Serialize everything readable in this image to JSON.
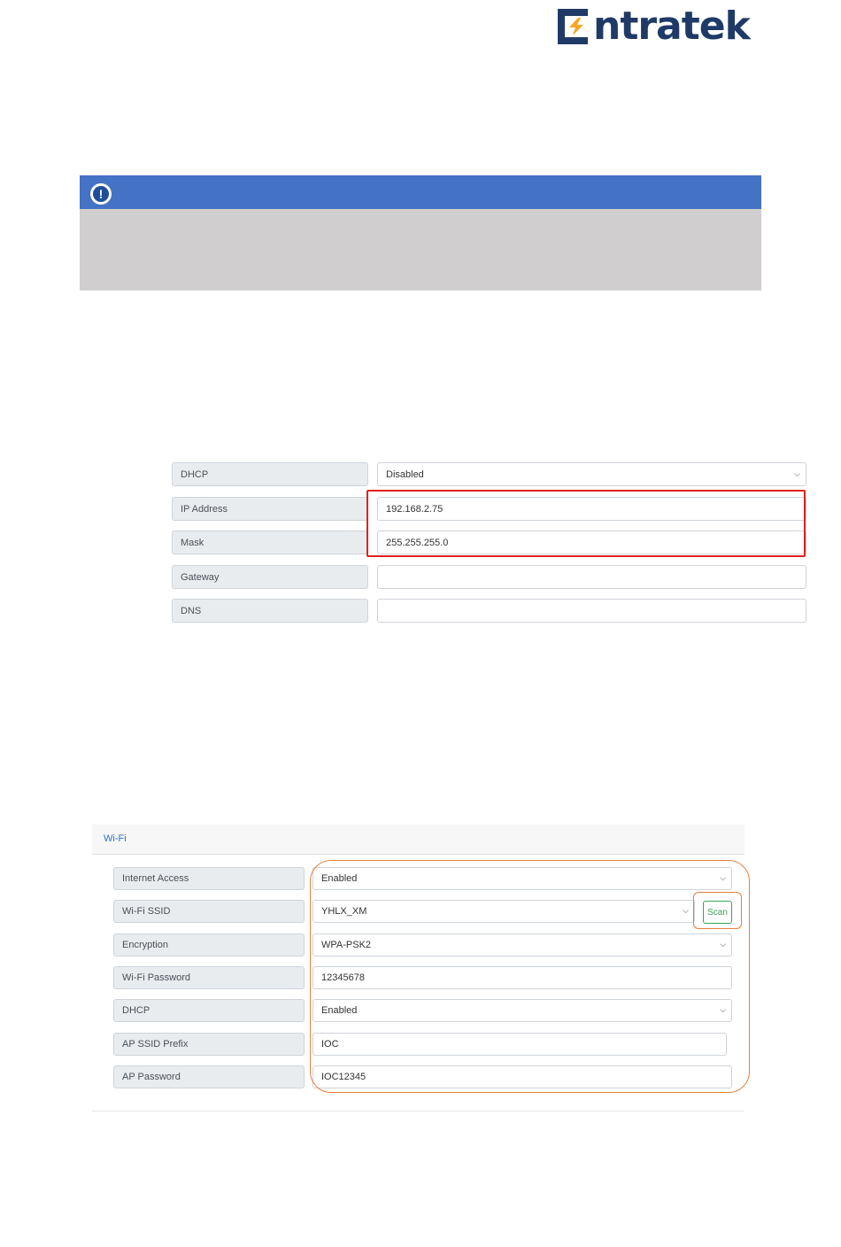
{
  "logo": {
    "text": "ntratek",
    "accent_color": "#f5a623",
    "brand_color": "#1f3a67"
  },
  "notice": {
    "icon": "exclamation-icon",
    "header_color": "#4472c4",
    "body_color": "#d0cece"
  },
  "network": {
    "rows": [
      {
        "label": "DHCP",
        "value": "Disabled",
        "type": "select"
      },
      {
        "label": "IP Address",
        "value": "192.168.2.75",
        "type": "input"
      },
      {
        "label": "Mask",
        "value": "255.255.255.0",
        "type": "input"
      },
      {
        "label": "Gateway",
        "value": "",
        "type": "input"
      },
      {
        "label": "DNS",
        "value": "",
        "type": "input"
      }
    ]
  },
  "wifi": {
    "title": "Wi-Fi",
    "scan_label": "Scan",
    "rows": [
      {
        "label": "Internet Access",
        "value": "Enabled",
        "type": "select"
      },
      {
        "label": "Wi-Fi SSID",
        "value": "YHLX_XM",
        "type": "select"
      },
      {
        "label": "Encryption",
        "value": "WPA-PSK2",
        "type": "select"
      },
      {
        "label": "Wi-Fi Password",
        "value": "12345678",
        "type": "input"
      },
      {
        "label": "DHCP",
        "value": "Enabled",
        "type": "select"
      },
      {
        "label": "AP SSID Prefix",
        "value": "IOC",
        "type": "input"
      },
      {
        "label": "AP Password",
        "value": "IOC12345",
        "type": "input"
      }
    ]
  }
}
